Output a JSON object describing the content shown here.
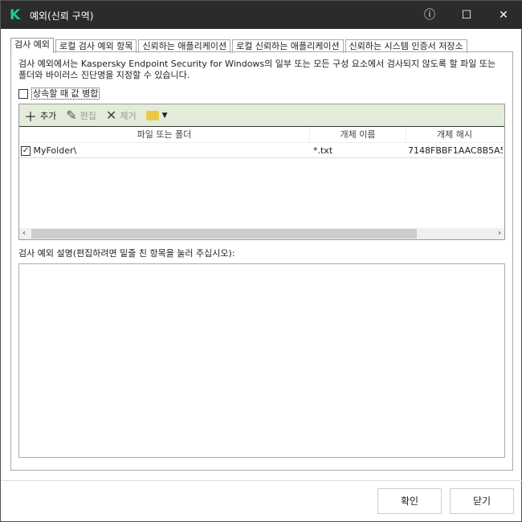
{
  "window": {
    "title": "예외(신뢰 구역)",
    "logo": "K"
  },
  "tabs": [
    "검사 예외",
    "로컬 검사 예외 항목",
    "신뢰하는 애플리케이션",
    "로컬 신뢰하는 애플리케이션",
    "신뢰하는 시스템 인증서 저장소"
  ],
  "description": "검사 예외에서는 Kaspersky Endpoint Security for Windows의 일부 또는 모든 구성 요소에서 검사되지 않도록 할 파일 또는 폴더와 바이러스 진단명을 지정할 수 있습니다.",
  "merge_label": "상속할 때 값 병합",
  "toolbar": {
    "add": "추가",
    "edit": "편집",
    "remove": "제거"
  },
  "columns": [
    "파일 또는 폴더",
    "개체 이름",
    "개체 해시"
  ],
  "rows": [
    {
      "checked": true,
      "path": "MyFolder\\",
      "name": "*.txt",
      "hash": "7148FBBF1AAC8B5A5..."
    }
  ],
  "desc_label": "검사 예외 설명(편집하려면 밑줄 친 항목을 눌러 주십시오):",
  "buttons": {
    "ok": "확인",
    "close": "닫기"
  }
}
